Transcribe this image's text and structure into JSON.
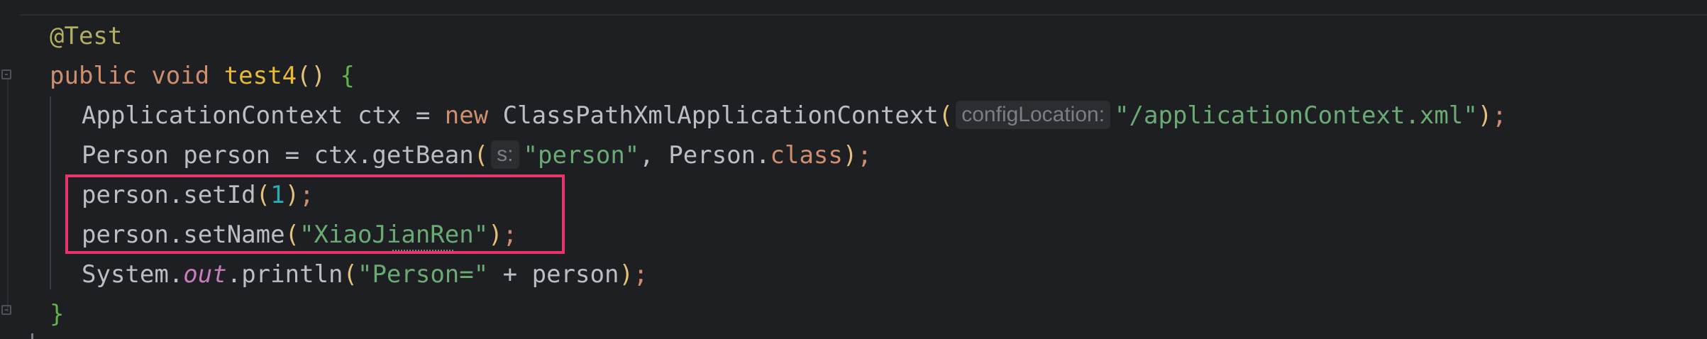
{
  "editor": {
    "line1": {
      "annotation": "@Test"
    },
    "line2": {
      "kw_public": "public",
      "kw_void": "void",
      "method_name": "test4",
      "parens": "()",
      "brace": "{"
    },
    "line3": {
      "type": "ApplicationContext",
      "var": " ctx = ",
      "kw_new": "new",
      "cls": " ClassPathXmlApplicationContext",
      "open": "(",
      "hint": "configLocation:",
      "arg": "\"/applicationContext.xml\"",
      "close": ")",
      "semi": ";"
    },
    "line4": {
      "prefix": "Person person = ctx.getBean",
      "open": "(",
      "hint": "s:",
      "arg": "\"person\"",
      "comma": ", Person.",
      "kw_class": "class",
      "close": ")",
      "semi": ";"
    },
    "line5": {
      "prefix": "person.setId",
      "open": "(",
      "num": "1",
      "close": ")",
      "semi": ";"
    },
    "line6": {
      "prefix": "person.setName",
      "open": "(",
      "arg": "\"XiaoJianRen\"",
      "close": ")",
      "semi": ";"
    },
    "line7": {
      "prefix": "System.",
      "static_field": "out",
      "method": ".println",
      "open": "(",
      "arg": "\"Person=\"",
      "rest": " + person",
      "close": ")",
      "semi": ";"
    },
    "line8": {
      "brace": "}"
    }
  },
  "colors": {
    "background": "#1e1f22",
    "highlight_box": "#e8336b",
    "keyword": "#cf8e6d",
    "string": "#6aab73",
    "annotation": "#b3ae60"
  }
}
